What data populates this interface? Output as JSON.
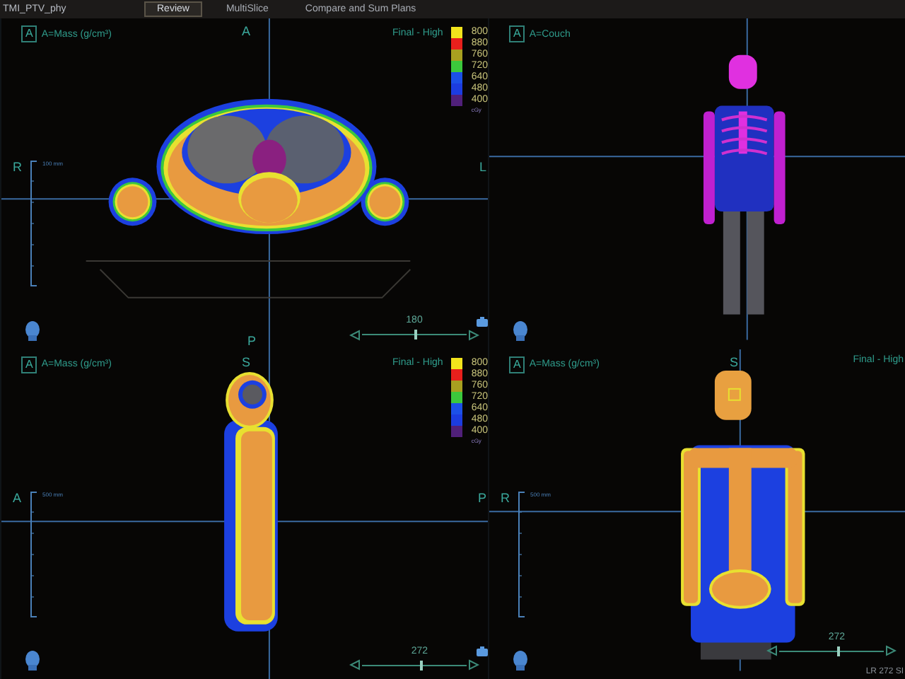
{
  "header": {
    "plan": "TMI_PTV_phy",
    "tabs": [
      {
        "label": "Review",
        "selected": true
      },
      {
        "label": "MultiSlice",
        "selected": false
      },
      {
        "label": "Compare and Sum Plans",
        "selected": false
      }
    ]
  },
  "viewports": [
    {
      "kind": "axial",
      "badge": "A",
      "label": "A=Mass (g/cm³)",
      "orientation": {
        "top": "A",
        "left": "R",
        "right": "L",
        "bottom": "P"
      },
      "scale": "100 mm",
      "slider": {
        "value": "180",
        "level": 0.5
      },
      "legend": {
        "title": "Final - High",
        "unit": "cGy",
        "entries": [
          {
            "value": "800",
            "color": "#f2e41c"
          },
          {
            "value": "880",
            "color": "#e8201c"
          },
          {
            "value": "760",
            "color": "#a8a020"
          },
          {
            "value": "720",
            "color": "#3cc83c"
          },
          {
            "value": "640",
            "color": "#1c50e8"
          },
          {
            "value": "480",
            "color": "#1c3ce0"
          },
          {
            "value": "400",
            "color": "#50207a"
          }
        ]
      }
    },
    {
      "kind": "volume",
      "badge": "A",
      "label": "A=Couch"
    },
    {
      "kind": "sagittal",
      "badge": "A",
      "label": "A=Mass (g/cm³)",
      "orientation": {
        "top": "S",
        "left": "A",
        "right": "P"
      },
      "scale": "500 mm",
      "slider": {
        "value": "272",
        "level": 0.55
      },
      "legend": {
        "title": "Final - High",
        "unit": "cGy",
        "entries": [
          {
            "value": "800",
            "color": "#f2e41c"
          },
          {
            "value": "880",
            "color": "#e8201c"
          },
          {
            "value": "760",
            "color": "#a8a020"
          },
          {
            "value": "720",
            "color": "#3cc83c"
          },
          {
            "value": "640",
            "color": "#1c50e8"
          },
          {
            "value": "480",
            "color": "#1c3ce0"
          },
          {
            "value": "400",
            "color": "#50207a"
          }
        ]
      }
    },
    {
      "kind": "coronal",
      "badge": "A",
      "label": "A=Mass (g/cm³)",
      "orientation": {
        "top": "S",
        "left": "R"
      },
      "corner_title": "Final - High",
      "scale": "500 mm",
      "slider": {
        "value": "272",
        "level": 0.55
      },
      "footer": "LR 272 SI"
    }
  ]
}
